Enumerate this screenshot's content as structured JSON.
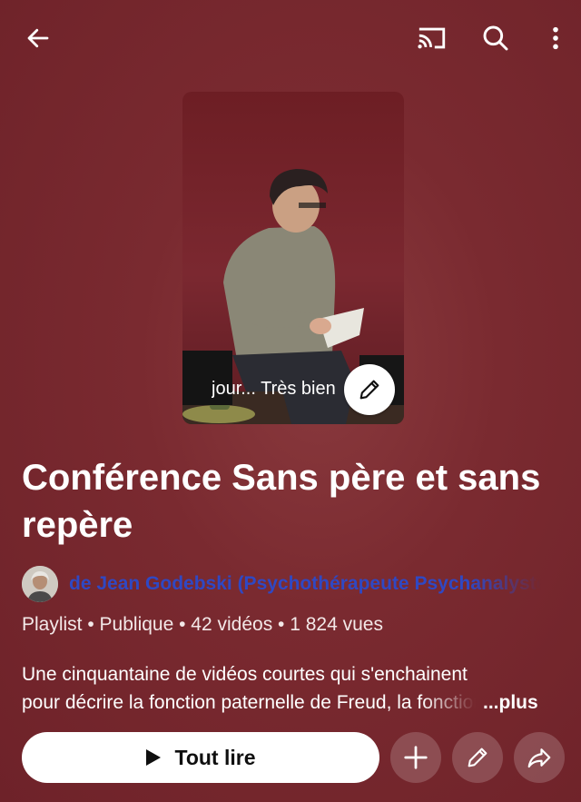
{
  "header": {
    "back_icon": "arrow-left-icon",
    "cast_icon": "cast-icon",
    "search_icon": "search-icon",
    "more_icon": "more-vertical-icon"
  },
  "thumbnail": {
    "caption": "jour... Très bien",
    "edit_icon": "pencil-icon"
  },
  "playlist": {
    "title": "Conférence Sans père et sans repère",
    "channel": "de Jean Godebski (Psychothérapeute Psychanalyste)",
    "meta": "Playlist • Publique • 42 vidéos • 1 824 vues",
    "description_line1": "Une cinquantaine de vidéos courtes qui s'enchainent",
    "description_line2": "pour décrire la fonction paternelle de Freud, la fonction",
    "more_label": "...plus"
  },
  "actions": {
    "play_all_label": "Tout lire",
    "add_icon": "plus-icon",
    "edit_icon": "pencil-icon",
    "share_icon": "share-icon"
  },
  "colors": {
    "background": "#7a2a30",
    "channel_link": "#2f48c4",
    "button_bg": "#ffffff"
  }
}
